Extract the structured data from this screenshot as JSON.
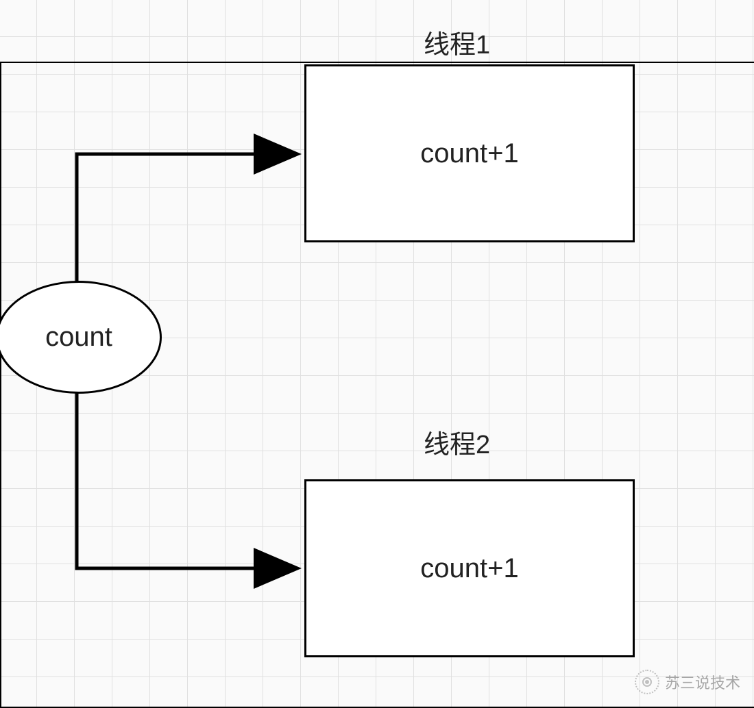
{
  "nodes": {
    "count_ellipse": "count",
    "thread1": {
      "title": "线程1",
      "box": "count+1"
    },
    "thread2": {
      "title": "线程2",
      "box": "count+1"
    }
  },
  "watermark": "苏三说技术"
}
